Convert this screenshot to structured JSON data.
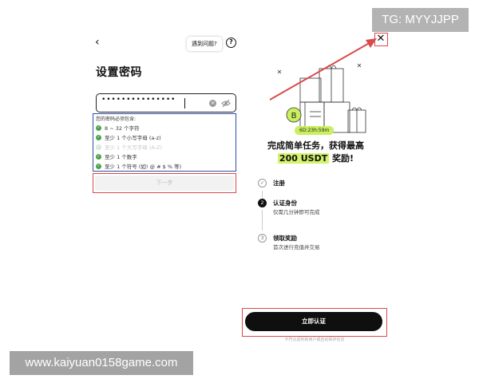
{
  "watermark_tg": "TG: MYYJJPP",
  "watermark_site": "www.kaiyuan0158game.com",
  "left": {
    "back_icon": "‹",
    "help_label": "遇到问题?",
    "help_icon": "?",
    "title": "设置密码",
    "password_value": "•••••••••••••••",
    "clear_icon": "×",
    "rules_title": "您的密码必须包含:",
    "rules": [
      {
        "text": "8 ~ 32 个字符",
        "met": true
      },
      {
        "text": "至少 1 个小写字母 (a-z)",
        "met": true
      },
      {
        "text": "至少 1 个大写字母 (A-Z)",
        "met": false
      },
      {
        "text": "至少 1 个数字",
        "met": true
      },
      {
        "text": "至少 1 个符号 (如! @ # $ % 等)",
        "met": true
      }
    ],
    "next_label": "下一步"
  },
  "right": {
    "close_icon": "✕",
    "timer": "6D:23h:59m",
    "headline_line1": "完成简单任务，获得最高",
    "headline_line2": "200 USDT",
    "headline_line2_suffix": " 奖励!",
    "steps": [
      {
        "num": "✓",
        "title": "注册",
        "sub": ""
      },
      {
        "num": "2",
        "title": "认证身份",
        "sub": "仅需几分钟即可完成"
      },
      {
        "num": "3",
        "title": "领取奖励",
        "sub": "首次进行充值并交易"
      }
    ],
    "cta_label": "立即认证",
    "footnote": "不符合返利新用户或自动保存信息"
  },
  "colors": {
    "accent_lime": "#c9ef5e",
    "highlight_box": "#d94a4a",
    "rules_box": "#2f4fa8",
    "check_green": "#4ba24b"
  }
}
